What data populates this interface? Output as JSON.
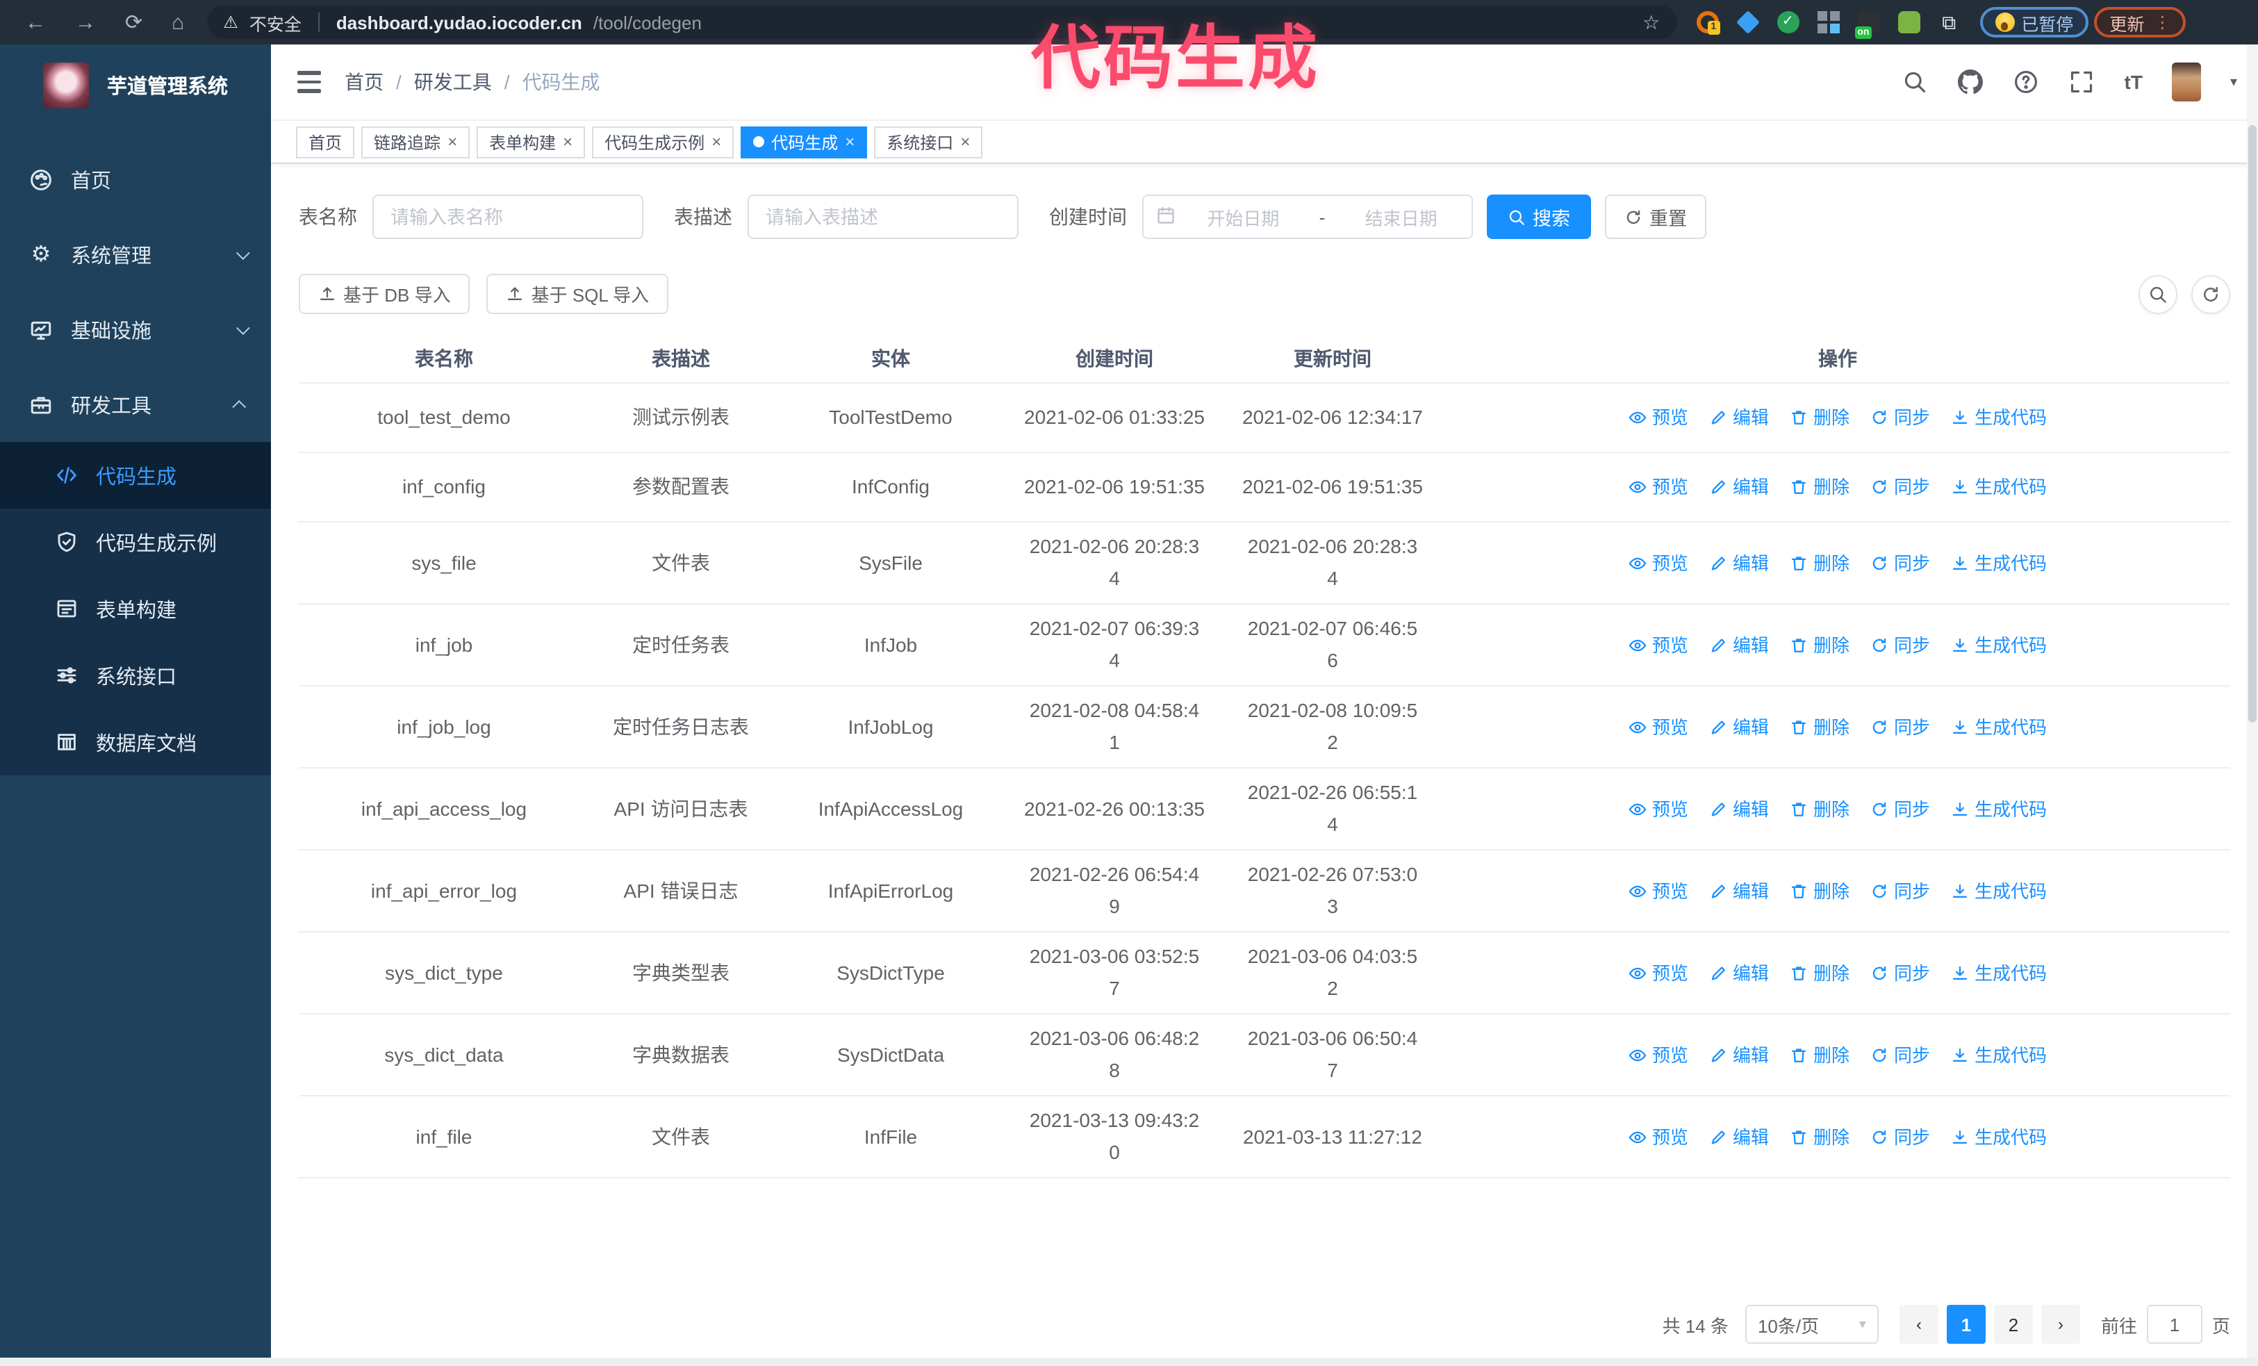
{
  "browser": {
    "not_secure_label": "不安全",
    "url_host": "dashboard.yudao.iocoder.cn",
    "url_path": "/tool/codegen",
    "paused_badge_label": "已暂停",
    "update_button_label": "更新"
  },
  "watermark_text": "代码生成",
  "sidebar": {
    "logo_title": "芋道管理系统",
    "items": [
      {
        "label": "首页"
      },
      {
        "label": "系统管理"
      },
      {
        "label": "基础设施"
      },
      {
        "label": "研发工具"
      }
    ],
    "sub_items": [
      {
        "label": "代码生成"
      },
      {
        "label": "代码生成示例"
      },
      {
        "label": "表单构建"
      },
      {
        "label": "系统接口"
      },
      {
        "label": "数据库文档"
      }
    ]
  },
  "header": {
    "breadcrumb": [
      "首页",
      "研发工具",
      "代码生成"
    ],
    "breadcrumb_separator": "/"
  },
  "tabs": [
    {
      "label": "首页"
    },
    {
      "label": "链路追踪"
    },
    {
      "label": "表单构建"
    },
    {
      "label": "代码生成示例"
    },
    {
      "label": "代码生成"
    },
    {
      "label": "系统接口"
    }
  ],
  "filters": {
    "table_name_label": "表名称",
    "table_name_placeholder": "请输入表名称",
    "table_desc_label": "表描述",
    "table_desc_placeholder": "请输入表描述",
    "create_time_label": "创建时间",
    "date_start_placeholder": "开始日期",
    "date_separator": "-",
    "date_end_placeholder": "结束日期",
    "search_label": "搜索",
    "reset_label": "重置"
  },
  "toolbar": {
    "import_db_label": "基于 DB 导入",
    "import_sql_label": "基于 SQL 导入"
  },
  "table": {
    "columns": [
      "表名称",
      "表描述",
      "实体",
      "创建时间",
      "更新时间",
      "操作"
    ],
    "action_labels": [
      "预览",
      "编辑",
      "删除",
      "同步",
      "生成代码"
    ],
    "rows": [
      {
        "name": "tool_test_demo",
        "desc": "测试示例表",
        "entity": "ToolTestDemo",
        "created": "2021-02-06 01:33:25",
        "updated": "2021-02-06 12:34:17"
      },
      {
        "name": "inf_config",
        "desc": "参数配置表",
        "entity": "InfConfig",
        "created": "2021-02-06 19:51:35",
        "updated": "2021-02-06 19:51:35"
      },
      {
        "name": "sys_file",
        "desc": "文件表",
        "entity": "SysFile",
        "created": "2021-02-06 20:28:3\n4",
        "updated": "2021-02-06 20:28:3\n4"
      },
      {
        "name": "inf_job",
        "desc": "定时任务表",
        "entity": "InfJob",
        "created": "2021-02-07 06:39:3\n4",
        "updated": "2021-02-07 06:46:5\n6"
      },
      {
        "name": "inf_job_log",
        "desc": "定时任务日志表",
        "entity": "InfJobLog",
        "created": "2021-02-08 04:58:4\n1",
        "updated": "2021-02-08 10:09:5\n2"
      },
      {
        "name": "inf_api_access_log",
        "desc": "API 访问日志表",
        "entity": "InfApiAccessLog",
        "created": "2021-02-26 00:13:35",
        "updated": "2021-02-26 06:55:1\n4"
      },
      {
        "name": "inf_api_error_log",
        "desc": "API 错误日志",
        "entity": "InfApiErrorLog",
        "created": "2021-02-26 06:54:4\n9",
        "updated": "2021-02-26 07:53:0\n3"
      },
      {
        "name": "sys_dict_type",
        "desc": "字典类型表",
        "entity": "SysDictType",
        "created": "2021-03-06 03:52:5\n7",
        "updated": "2021-03-06 04:03:5\n2"
      },
      {
        "name": "sys_dict_data",
        "desc": "字典数据表",
        "entity": "SysDictData",
        "created": "2021-03-06 06:48:2\n8",
        "updated": "2021-03-06 06:50:4\n7"
      },
      {
        "name": "inf_file",
        "desc": "文件表",
        "entity": "InfFile",
        "created": "2021-03-13 09:43:2\n0",
        "updated": "2021-03-13 11:27:12"
      }
    ]
  },
  "pagination": {
    "total_label": "共 14 条",
    "page_size_label": "10条/页",
    "page_1": "1",
    "page_2": "2",
    "goto_label": "前往",
    "goto_value": "1",
    "goto_suffix": "页"
  },
  "icons": {
    "back": "←",
    "forward": "→",
    "reload": "⟳",
    "home": "⌂",
    "warning": "⚠",
    "star": "☆",
    "close": "×",
    "dots": "⋮",
    "gear": "⚙",
    "caret_down": "▾",
    "font_size": "tT",
    "badge_one": "1",
    "badge_on": "on",
    "check": "✓",
    "puzzle": "⧉",
    "prev": "‹",
    "next": "›"
  },
  "colors": {
    "accent": "#1890ff",
    "sidebar_bg": "#20415b",
    "watermark": "#fb4b6c"
  }
}
